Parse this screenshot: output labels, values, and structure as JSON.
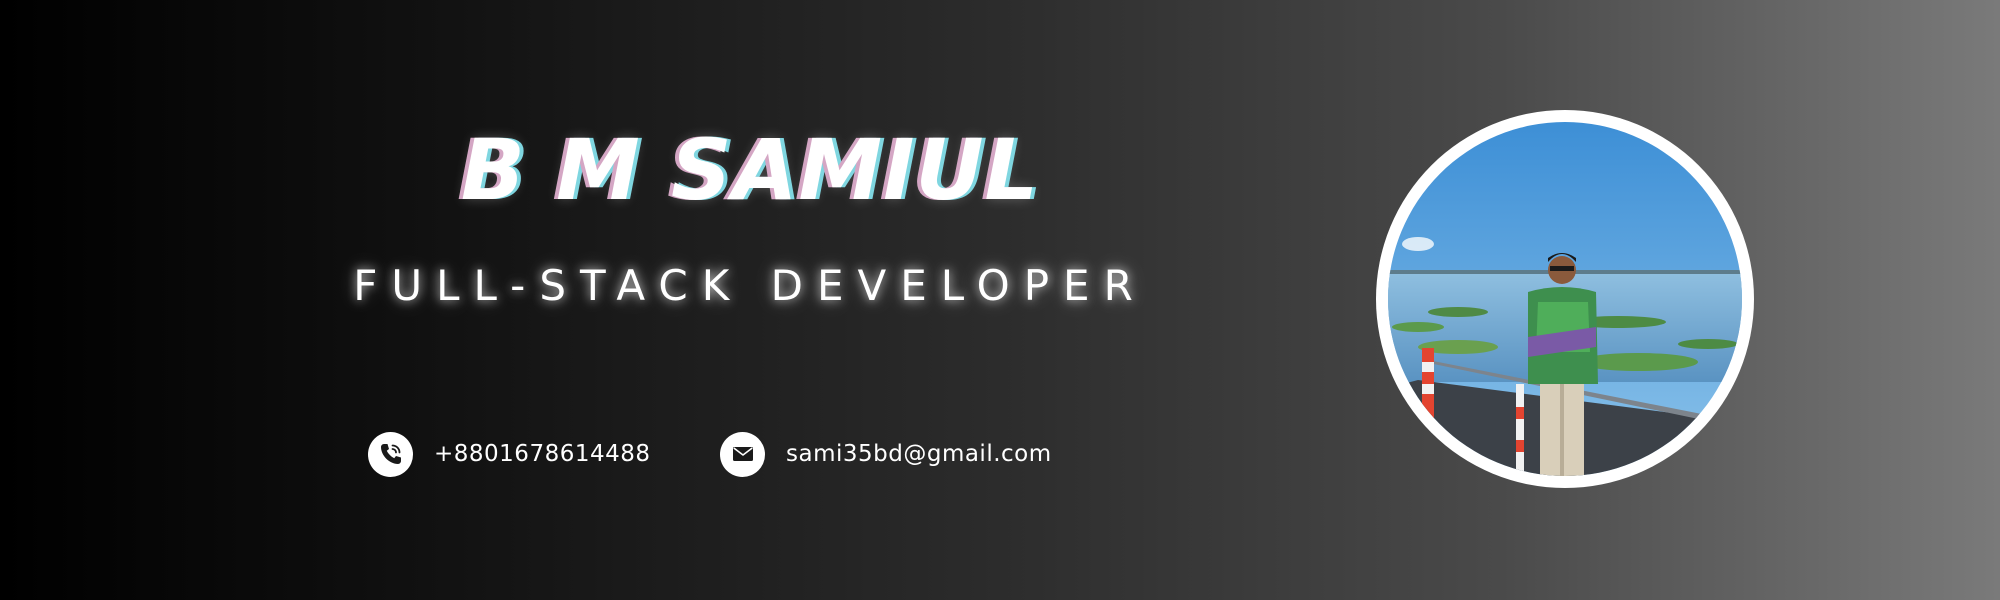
{
  "profile": {
    "name": "B M SAMIUL",
    "title": "FULL-STACK DEVELOPER"
  },
  "contacts": {
    "phone": {
      "icon": "phone-icon",
      "text": "+8801678614488"
    },
    "email": {
      "icon": "envelope-icon",
      "text": "sami35bd@gmail.com"
    }
  },
  "colors": {
    "background_start": "#000000",
    "background_end": "#7a7a7a",
    "text": "#ffffff",
    "name_shadow_left": "#d4a6c4",
    "name_shadow_right": "#7fd6e0"
  }
}
